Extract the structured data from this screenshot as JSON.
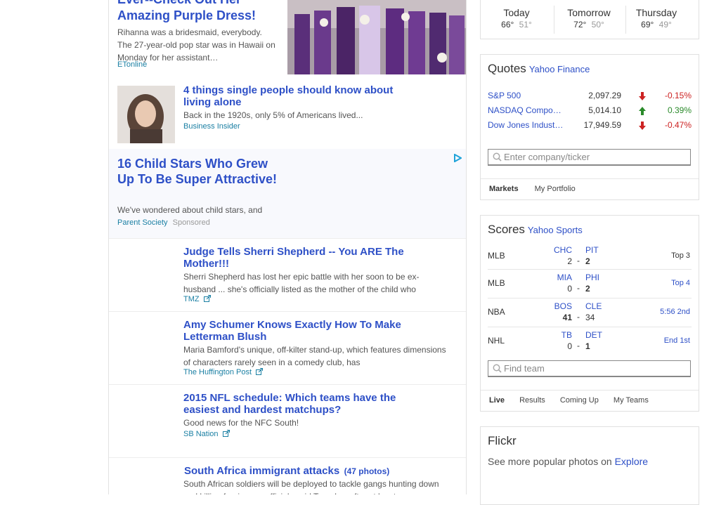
{
  "stream": {
    "items": [
      {
        "title": "Ever--Check Out Her Amazing Purple Dress!",
        "summary": "Rihanna was a bridesmaid, everybody. The 27-year-old pop star was in Hawaii on Monday for her assistant…",
        "source": "ETonline"
      },
      {
        "title": "4 things single people should know about living alone",
        "summary": "Back in the 1920s, only 5% of Americans lived...",
        "source": "Business Insider"
      },
      {
        "title": "16 Child Stars Who Grew Up To Be Super Attractive!",
        "summary": "We've wondered about child stars, and",
        "source": "Parent Society",
        "sponsored": "Sponsored"
      },
      {
        "title": "Judge Tells Sherri Shepherd -- You ARE The Mother!!!",
        "summary": "Sherri Shepherd has lost her epic battle with her soon to be ex-husband ... she's officially listed as the mother of the child who",
        "source": "TMZ"
      },
      {
        "title": "Amy Schumer Knows Exactly How To Make Letterman Blush",
        "summary": "Maria Bamford's unique, off-kilter stand-up, which features dimensions of characters rarely seen in a comedy club, has",
        "source": "The Huffington Post"
      },
      {
        "title": "2015 NFL schedule: Which teams have the easiest and hardest matchups?",
        "summary": "Good news for the NFC South!",
        "source": "SB Nation"
      },
      {
        "title": "South Africa immigrant attacks",
        "photos": "(47 photos)",
        "summary": "South African soldiers will be deployed to tackle gangs hunting down and killing foreigners, officials said Tuesday, after at least"
      }
    ]
  },
  "weather": {
    "days": [
      {
        "name": "Today",
        "high": "66°",
        "low": "51°"
      },
      {
        "name": "Tomorrow",
        "high": "72°",
        "low": "50°"
      },
      {
        "name": "Thursday",
        "high": "69°",
        "low": "49°"
      }
    ]
  },
  "quotes": {
    "title": "Quotes",
    "provider": "Yahoo Finance",
    "rows": [
      {
        "name": "S&P 500",
        "value": "2,097.29",
        "change": "-0.15%",
        "direction": "down"
      },
      {
        "name": "NASDAQ Compo…",
        "value": "5,014.10",
        "change": "0.39%",
        "direction": "up"
      },
      {
        "name": "Dow Jones Indust…",
        "value": "17,949.59",
        "change": "-0.47%",
        "direction": "down"
      }
    ],
    "search_placeholder": "Enter company/ticker",
    "tabs": [
      "Markets",
      "My Portfolio"
    ],
    "colors": {
      "down": "#cc2222",
      "up": "#2a8a2a"
    }
  },
  "scores": {
    "title": "Scores",
    "provider": "Yahoo Sports",
    "games": [
      {
        "league": "MLB",
        "away": "CHC",
        "home": "PIT",
        "away_score": "2",
        "home_score": "2",
        "status": "Top 3",
        "status_link": false,
        "bold": "home"
      },
      {
        "league": "MLB",
        "away": "MIA",
        "home": "PHI",
        "away_score": "0",
        "home_score": "2",
        "status": "Top 4",
        "status_link": true,
        "bold": "home"
      },
      {
        "league": "NBA",
        "away": "BOS",
        "home": "CLE",
        "away_score": "41",
        "home_score": "34",
        "status": "5:56 2nd",
        "status_link": true,
        "bold": "away"
      },
      {
        "league": "NHL",
        "away": "TB",
        "home": "DET",
        "away_score": "0",
        "home_score": "1",
        "status": "End 1st",
        "status_link": true,
        "bold": "home"
      }
    ],
    "search_placeholder": "Find team",
    "tabs": [
      "Live",
      "Results",
      "Coming Up",
      "My Teams"
    ]
  },
  "flickr": {
    "title": "Flickr",
    "text": "See more popular photos on",
    "link": "Explore"
  }
}
